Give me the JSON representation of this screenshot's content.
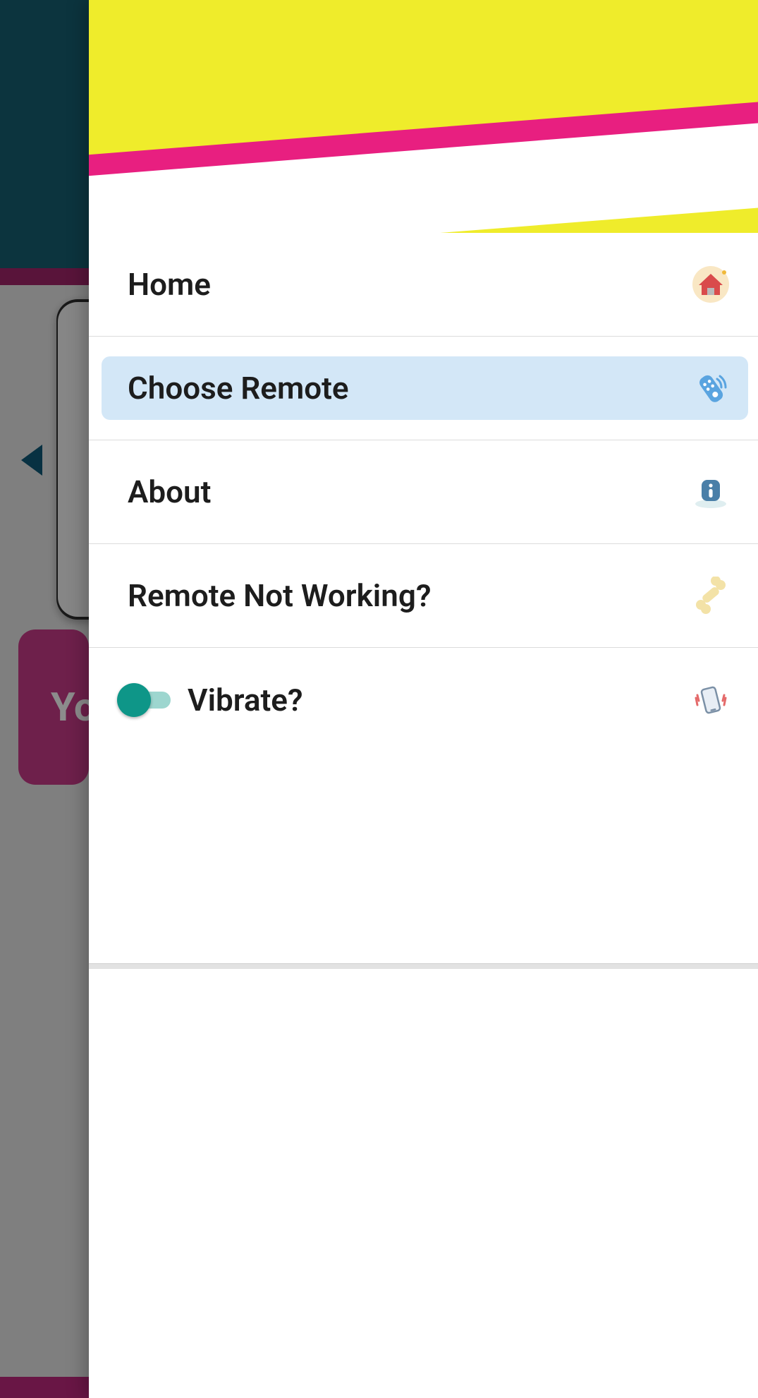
{
  "backdrop": {
    "button_fragment": "Yo"
  },
  "drawer": {
    "items": [
      {
        "label": "Home",
        "icon": "home-icon"
      },
      {
        "label": "Choose Remote",
        "icon": "remote-icon",
        "selected": true
      },
      {
        "label": "About",
        "icon": "info-icon"
      },
      {
        "label": "Remote Not Working?",
        "icon": "bone-icon"
      }
    ],
    "vibrate": {
      "label": "Vibrate?",
      "icon": "vibrate-icon",
      "enabled": true
    }
  }
}
